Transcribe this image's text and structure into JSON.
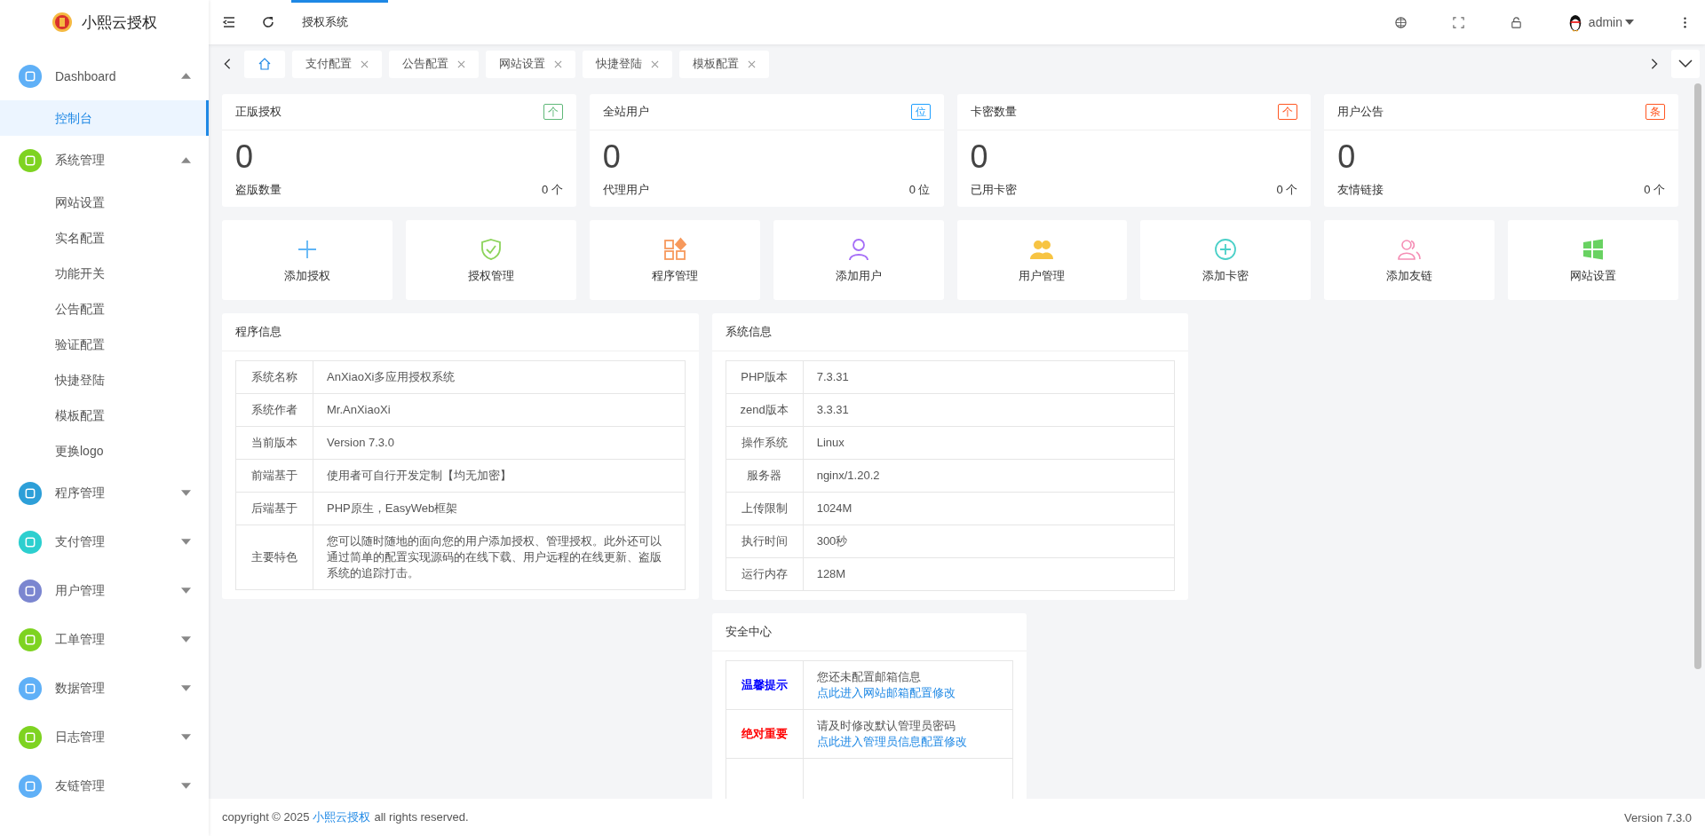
{
  "brand": {
    "name": "小熙云授权"
  },
  "header": {
    "nav": [
      {
        "label": "授权系统",
        "selected": true
      }
    ],
    "user": "admin"
  },
  "sidebar": {
    "items": [
      {
        "label": "Dashboard",
        "color": "#5fb0f7",
        "expanded": true,
        "children": [
          {
            "label": "控制台",
            "selected": true
          }
        ]
      },
      {
        "label": "系统管理",
        "color": "#7ed321",
        "expanded": true,
        "children": [
          {
            "label": "网站设置",
            "selected": false
          },
          {
            "label": "实名配置",
            "selected": false
          },
          {
            "label": "功能开关",
            "selected": false
          },
          {
            "label": "公告配置",
            "selected": false
          },
          {
            "label": "验证配置",
            "selected": false
          },
          {
            "label": "快捷登陆",
            "selected": false
          },
          {
            "label": "模板配置",
            "selected": false
          },
          {
            "label": "更换logo",
            "selected": false
          }
        ]
      },
      {
        "label": "程序管理",
        "color": "#2d9fd8",
        "expanded": false
      },
      {
        "label": "支付管理",
        "color": "#2ccfcf",
        "expanded": false
      },
      {
        "label": "用户管理",
        "color": "#7b86d0",
        "expanded": false
      },
      {
        "label": "工单管理",
        "color": "#7ed321",
        "expanded": false
      },
      {
        "label": "数据管理",
        "color": "#5fb0f7",
        "expanded": false
      },
      {
        "label": "日志管理",
        "color": "#7ed321",
        "expanded": false
      },
      {
        "label": "友链管理",
        "color": "#5fb0f7",
        "expanded": false
      }
    ]
  },
  "tabs": [
    {
      "kind": "home",
      "selected": true
    },
    {
      "label": "支付配置",
      "selected": false
    },
    {
      "label": "公告配置",
      "selected": false
    },
    {
      "label": "网站设置",
      "selected": false
    },
    {
      "label": "快捷登陆",
      "selected": false
    },
    {
      "label": "模板配置",
      "selected": false
    }
  ],
  "stats": [
    {
      "title": "正版授权",
      "badge": "个",
      "color": "#5fb878",
      "value": "0",
      "sub_label": "盗版数量",
      "sub_value": "0 个"
    },
    {
      "title": "全站用户",
      "badge": "位",
      "color": "#1e9fff",
      "value": "0",
      "sub_label": "代理用户",
      "sub_value": "0 位"
    },
    {
      "title": "卡密数量",
      "badge": "个",
      "color": "#ff5722",
      "value": "0",
      "sub_label": "已用卡密",
      "sub_value": "0 个"
    },
    {
      "title": "用户公告",
      "badge": "条",
      "color": "#ff5722",
      "value": "0",
      "sub_label": "友情链接",
      "sub_value": "0 个"
    }
  ],
  "shortcuts": [
    {
      "label": "添加授权",
      "color": "#5fb5f6"
    },
    {
      "label": "授权管理",
      "color": "#8cd35a"
    },
    {
      "label": "程序管理",
      "color": "#f7995c"
    },
    {
      "label": "添加用户",
      "color": "#a56ef7"
    },
    {
      "label": "用户管理",
      "color": "#f7c443"
    },
    {
      "label": "添加卡密",
      "color": "#4bd0c8"
    },
    {
      "label": "添加友链",
      "color": "#f58eb5"
    },
    {
      "label": "网站设置",
      "color": "#69d262"
    }
  ],
  "program_info": {
    "title": "程序信息",
    "rows": [
      {
        "label": "系统名称",
        "value": "AnXiaoXi多应用授权系统"
      },
      {
        "label": "系统作者",
        "value": "Mr.AnXiaoXi"
      },
      {
        "label": "当前版本",
        "value": "Version 7.3.0"
      },
      {
        "label": "前端基于",
        "value": "使用者可自行开发定制【均无加密】"
      },
      {
        "label": "后端基于",
        "value": "PHP原生，EasyWeb框架"
      },
      {
        "label": "主要特色",
        "value": "您可以随时随地的面向您的用户添加授权、管理授权。此外还可以通过简单的配置实现源码的在线下载、用户远程的在线更新、盗版系统的追踪打击。"
      }
    ]
  },
  "system_info": {
    "title": "系统信息",
    "rows": [
      {
        "label": "PHP版本",
        "value": "7.3.31"
      },
      {
        "label": "zend版本",
        "value": "3.3.31"
      },
      {
        "label": "操作系统",
        "value": "Linux"
      },
      {
        "label": "服务器",
        "value": "nginx/1.20.2"
      },
      {
        "label": "上传限制",
        "value": "1024M"
      },
      {
        "label": "执行时间",
        "value": "300秒"
      },
      {
        "label": "运行内存",
        "value": "128M"
      }
    ]
  },
  "security": {
    "title": "安全中心",
    "rows": [
      {
        "label": "温馨提示",
        "color": "#0000ff",
        "text": "您还未配置邮箱信息",
        "link": "点此进入网站邮箱配置修改"
      },
      {
        "label": "绝对重要",
        "color": "#ff0000",
        "text": "请及时修改默认管理员密码",
        "link": "点此进入管理员信息配置修改"
      }
    ]
  },
  "footer": {
    "copyright": "copyright © 2025",
    "link": "小熙云授权",
    "suffix": "all rights reserved.",
    "version": "Version 7.3.0"
  }
}
